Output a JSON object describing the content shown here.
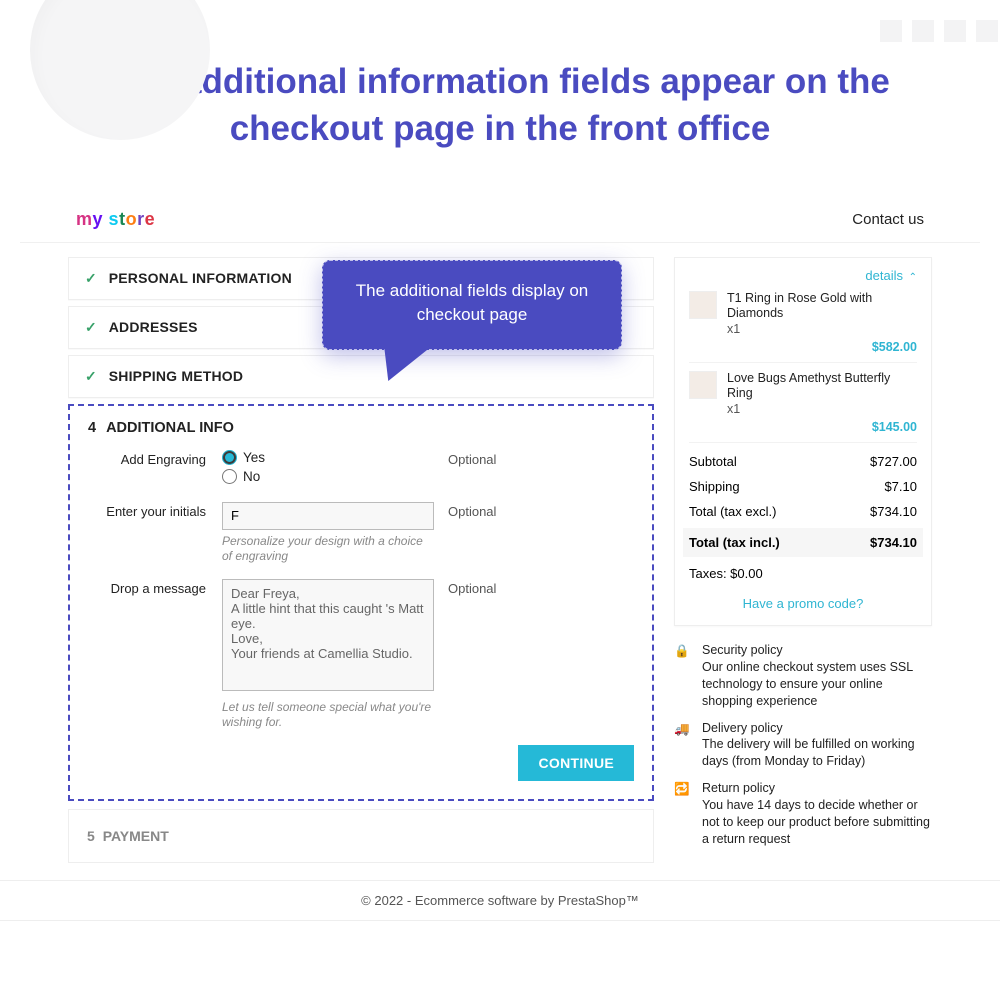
{
  "headline": "The additional information fields appear on the checkout page in the front office",
  "callout": "The additional fields display on checkout page",
  "header": {
    "logo": "my store",
    "contact": "Contact us"
  },
  "steps": {
    "s1": "PERSONAL INFORMATION",
    "s2": "ADDRESSES",
    "s3": "SHIPPING METHOD",
    "s4_num": "4",
    "s4": "ADDITIONAL INFO",
    "s5_num": "5",
    "s5": "PAYMENT"
  },
  "form": {
    "engraving_label": "Add Engraving",
    "yes": "Yes",
    "no": "No",
    "optional": "Optional",
    "initials_label": "Enter your initials",
    "initials_value": "F",
    "initials_hint": "Personalize your design with a choice of engraving",
    "msg_label": "Drop a message",
    "msg_value": "Dear Freya,\nA little hint that this caught 's Matt eye.\nLove,\nYour friends at Camellia Studio.",
    "msg_hint": "Let us tell someone special what you're wishing for.",
    "continue": "CONTINUE"
  },
  "cart": {
    "show_details": "details",
    "items": [
      {
        "name": "T1 Ring in Rose Gold with Diamonds",
        "qty": "x1",
        "price": "$582.00"
      },
      {
        "name": "Love Bugs Amethyst Butterfly Ring",
        "qty": "x1",
        "price": "$145.00"
      }
    ],
    "subtotal_l": "Subtotal",
    "subtotal_v": "$727.00",
    "shipping_l": "Shipping",
    "shipping_v": "$7.10",
    "totex_l": "Total (tax excl.)",
    "totex_v": "$734.10",
    "totin_l": "Total (tax incl.)",
    "totin_v": "$734.10",
    "taxes": "Taxes: $0.00",
    "promo": "Have a promo code?"
  },
  "policies": {
    "sec_t": "Security policy",
    "sec_b": "Our online checkout system uses SSL technology to ensure your online shopping experience",
    "del_t": "Delivery policy",
    "del_b": "The delivery will be fulfilled on working days (from Monday to Friday)",
    "ret_t": "Return policy",
    "ret_b": "You have 14 days to decide whether or not to keep our product before submitting a return request"
  },
  "footer": "© 2022 - Ecommerce software by PrestaShop™"
}
